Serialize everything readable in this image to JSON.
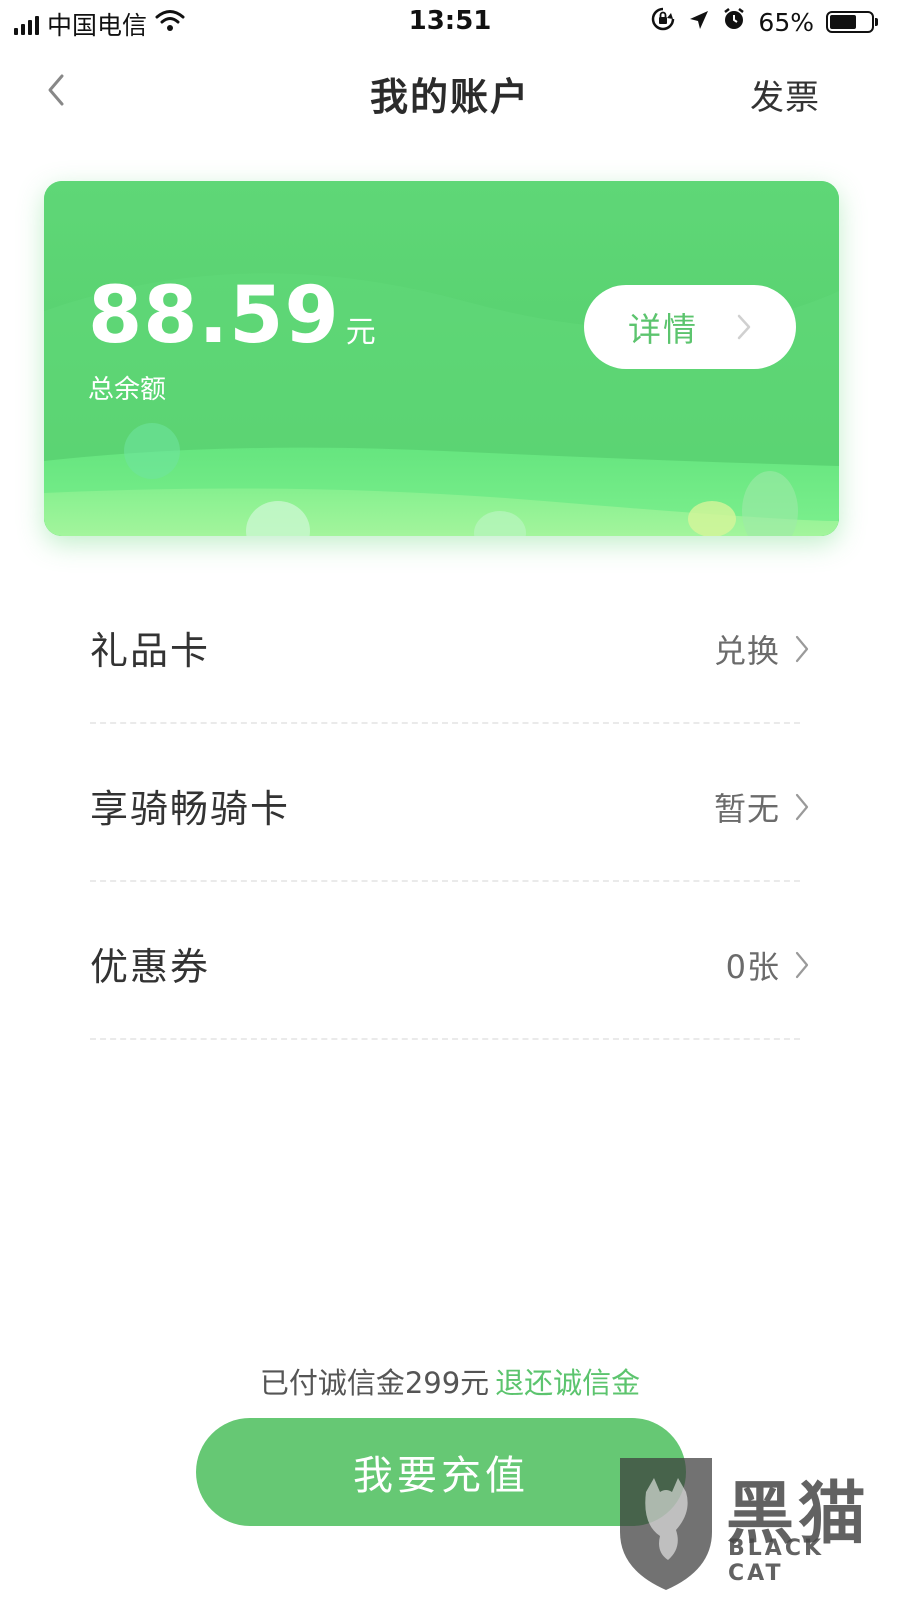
{
  "status_bar": {
    "carrier": "中国电信",
    "time": "13:51",
    "battery_percent": "65%",
    "battery_level": 0.65,
    "icons": [
      "signal-icon",
      "wifi-icon",
      "orientation-lock-icon",
      "location-icon",
      "alarm-icon",
      "battery-icon"
    ]
  },
  "nav": {
    "title": "我的账户",
    "invoice_label": "发票",
    "back_icon": "chevron-left-icon"
  },
  "balance_card": {
    "amount": "88.59",
    "unit": "元",
    "label": "总余额",
    "detail_label": "详情",
    "background_color": "#5ad372"
  },
  "menu": {
    "items": [
      {
        "label": "礼品卡",
        "value": "兑换"
      },
      {
        "label": "享骑畅骑卡",
        "value": "暂无"
      },
      {
        "label": "优惠券",
        "value": "0张"
      }
    ]
  },
  "deposit": {
    "text": "已付诚信金299元",
    "refund_link": "退还诚信金"
  },
  "recharge": {
    "label": "我要充值"
  },
  "watermark": {
    "text": "黑猫",
    "sub": "BLACK CAT"
  },
  "colors": {
    "accent": "#5cc46e",
    "button": "#66c874"
  }
}
